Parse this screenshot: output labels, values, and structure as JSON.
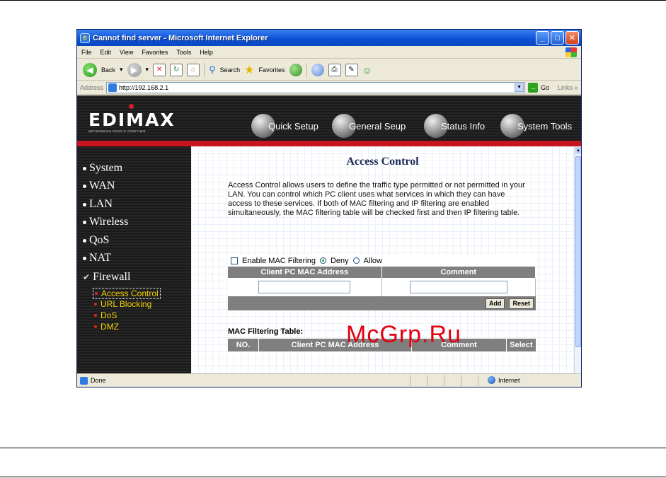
{
  "window": {
    "title": "Cannot find server - Microsoft Internet Explorer",
    "minimize": "_",
    "maximize": "□",
    "close": "✕"
  },
  "menu": [
    "File",
    "Edit",
    "View",
    "Favorites",
    "Tools",
    "Help"
  ],
  "toolbar": {
    "back": "Back",
    "search": "Search",
    "favorites": "Favorites"
  },
  "address": {
    "label": "Address",
    "url": "http://192.168.2.1",
    "go": "Go",
    "links": "Links »"
  },
  "banner": {
    "brand": "EDIMAX",
    "tagline": "NETWORKING PEOPLE TOGETHER",
    "nav": [
      "Quick Setup",
      "General Seup",
      "Status Info",
      "System Tools"
    ]
  },
  "sidebar": {
    "items": [
      "System",
      "WAN",
      "LAN",
      "Wireless",
      "QoS",
      "NAT",
      "Firewall"
    ],
    "sub_items": [
      "Access Control",
      "URL Blocking",
      "DoS",
      "DMZ"
    ]
  },
  "content": {
    "title": "Access Control",
    "description": "Access Control allows users to define the traffic type permitted or not permitted in your LAN. You can control which PC client uses what services in which they can have access to these services. If both of MAC filtering and IP filtering are enabled simultaneously, the MAC filtering table will be checked first and then IP filtering table.",
    "enable_label": "Enable MAC Filtering",
    "deny": "Deny",
    "allow": "Allow",
    "col_mac": "Client PC MAC Address",
    "col_comment": "Comment",
    "add": "Add",
    "reset": "Reset",
    "table_label": "MAC Filtering Table:",
    "table_cols": [
      "NO.",
      "Client PC MAC Address",
      "Comment",
      "Select"
    ]
  },
  "status": {
    "text": "Done",
    "zone": "Internet"
  },
  "watermark": "McGrp.Ru"
}
